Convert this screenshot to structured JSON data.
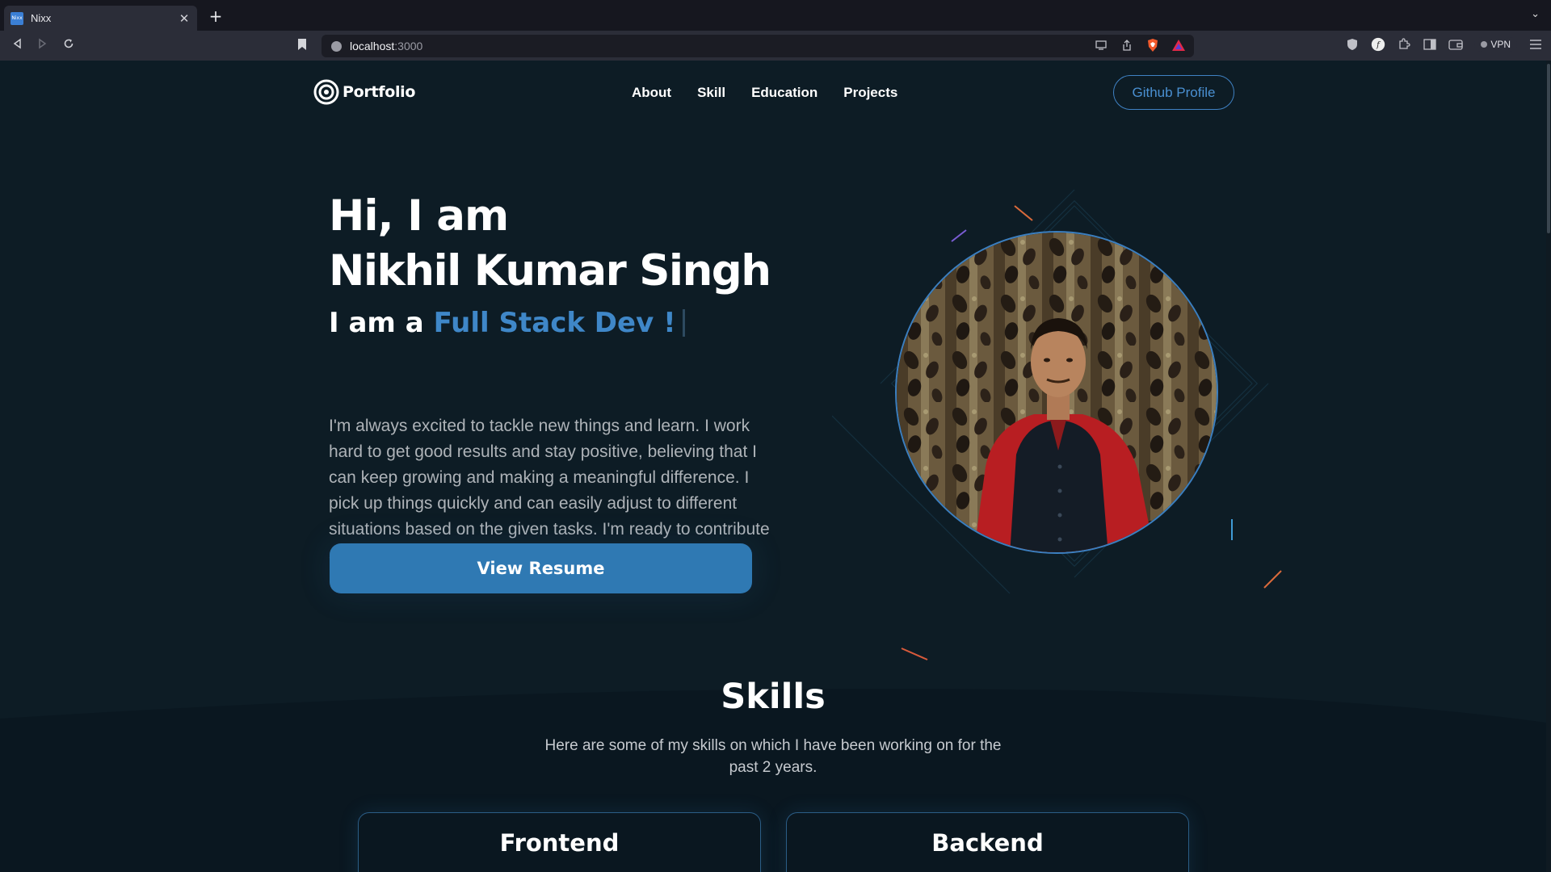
{
  "browser": {
    "tab_title": "Nixx",
    "favicon_text": "Nixx",
    "url_host": "localhost",
    "url_port": ":3000",
    "vpn_label": "VPN"
  },
  "nav": {
    "logo_text": "Portfolio",
    "menu": [
      "About",
      "Skill",
      "Education",
      "Projects"
    ],
    "github_label": "Github Profile"
  },
  "hero": {
    "greeting": "Hi, I am",
    "name": "Nikhil Kumar Singh",
    "role_prefix": "I am a",
    "role_value": "Full Stack Dev !",
    "description": "I'm always excited to tackle new things and learn. I work hard to get good results and stay positive, believing that I can keep growing and making a meaningful difference. I pick up things quickly and can easily adjust to different situations based on the given tasks. I'm ready to contribute and achieve great things.",
    "resume_label": "View Resume"
  },
  "skills": {
    "title": "Skills",
    "subtitle": "Here are some of my skills on which I have been working on for the past 2 years.",
    "cards": [
      "Frontend",
      "Backend"
    ]
  },
  "colors": {
    "page_bg": "#0d1c25",
    "accent": "#3f87c8",
    "button": "#2f79b3"
  }
}
